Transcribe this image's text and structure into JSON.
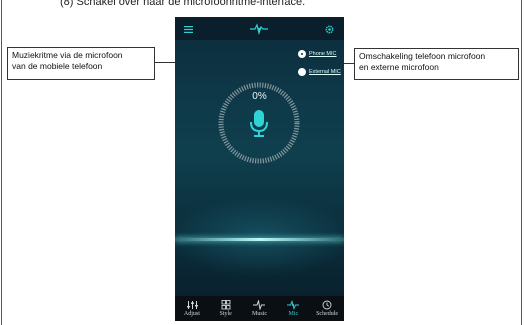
{
  "document": {
    "heading": "(8) Schakel over naar de microfoonritme-interface."
  },
  "callouts": {
    "left": {
      "line1": "Muziekritme via de microfoon",
      "line2": "van de mobiele telefoon"
    },
    "right": {
      "line1": "Omschakeling telefoon microfoon",
      "line2": "en externe microfoon"
    }
  },
  "app": {
    "menu_icon": "menu-icon",
    "logo_icon": "pulse-logo-icon",
    "settings_icon": "gear-icon",
    "mic_options": [
      {
        "label": "Phone MIC",
        "selected": true
      },
      {
        "label": "External MIC",
        "selected": false
      }
    ],
    "level_percent": "0%",
    "level_value": 0,
    "accent_color": "#2fd3d6",
    "nav": [
      {
        "label": "Adjust",
        "icon": "sliders-icon",
        "active": false
      },
      {
        "label": "Style",
        "icon": "grid-icon",
        "active": false
      },
      {
        "label": "Music",
        "icon": "music-icon",
        "active": false
      },
      {
        "label": "Mic",
        "icon": "pulse-icon",
        "active": true
      },
      {
        "label": "Schedule",
        "icon": "clock-icon",
        "active": false
      }
    ]
  }
}
